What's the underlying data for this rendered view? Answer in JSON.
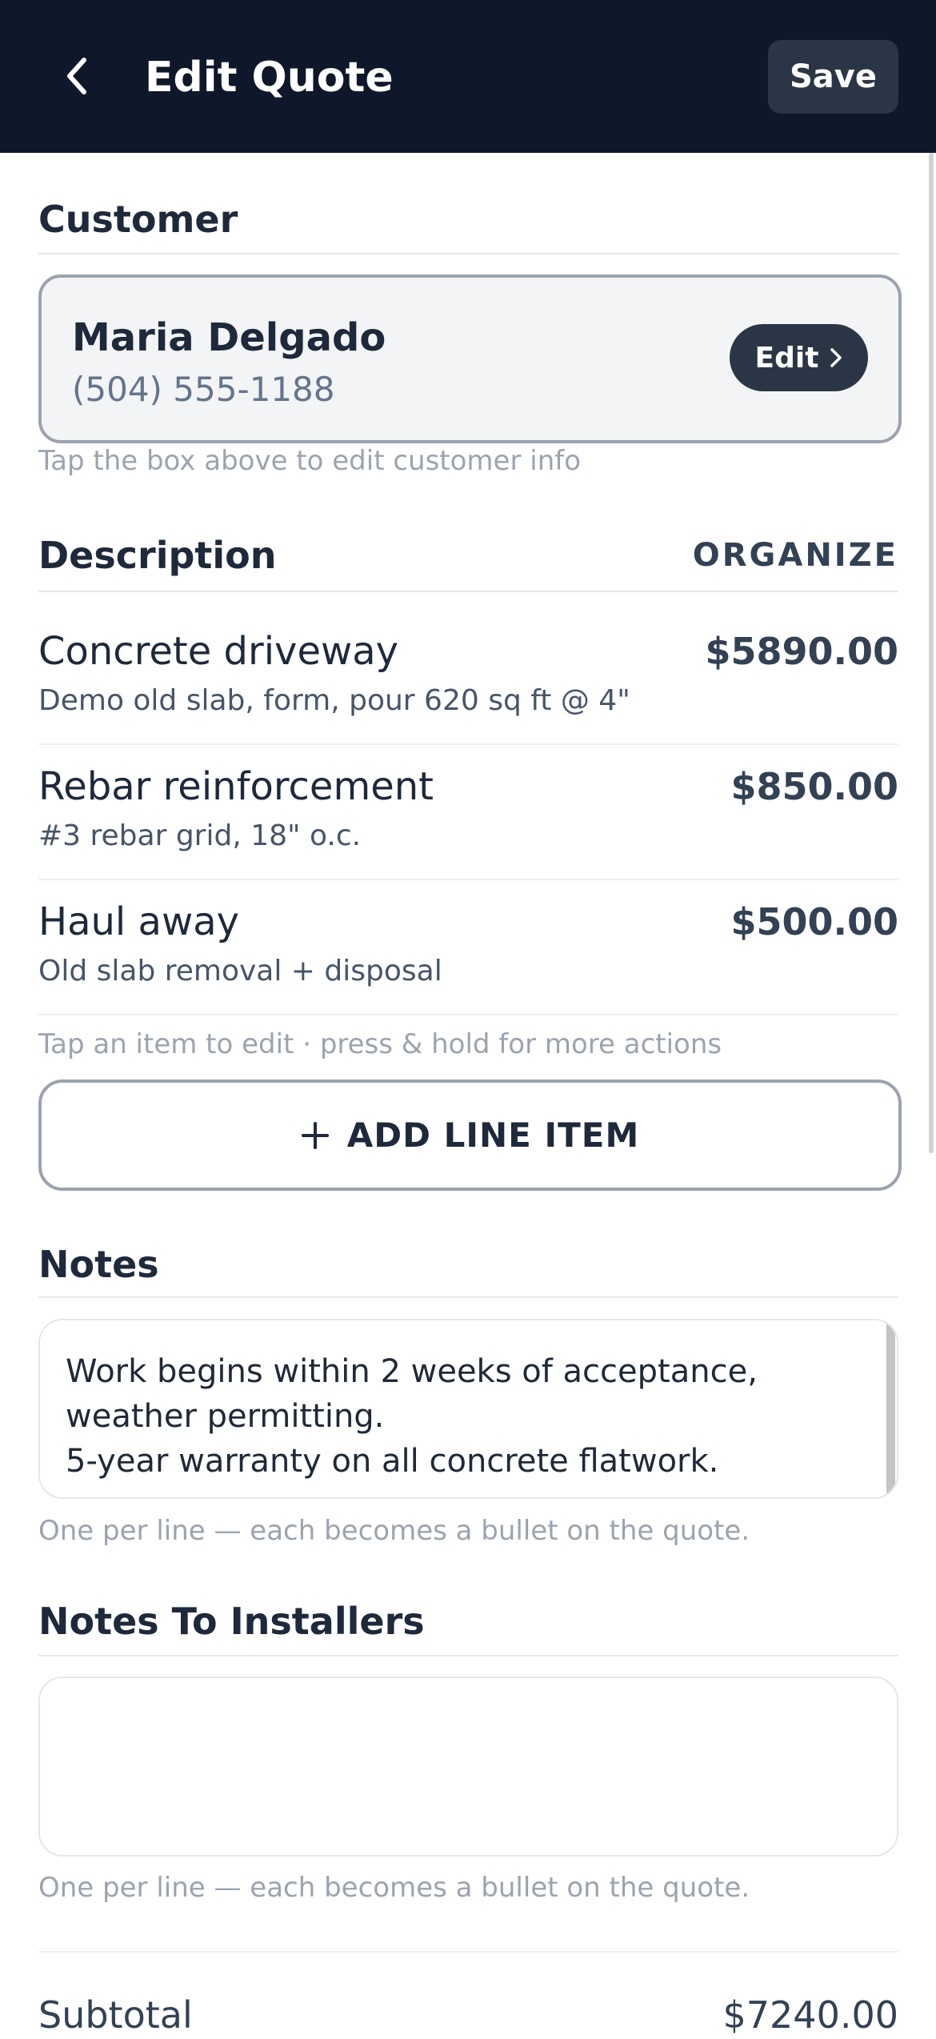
{
  "header": {
    "title": "Edit Quote",
    "save_label": "Save",
    "back_icon": "chevron-left-icon"
  },
  "customer": {
    "section_title": "Customer",
    "name": "Maria Delgado",
    "phone": "(504) 555-1188",
    "edit_label": "Edit",
    "hint": "Tap the box above to edit customer info"
  },
  "description": {
    "section_title": "Description",
    "organize_label": "ORGANIZE",
    "items": [
      {
        "name": "Concrete driveway",
        "detail": "Demo old slab, form, pour 620 sq ft @ 4\"",
        "price": "$5890.00"
      },
      {
        "name": "Rebar reinforcement",
        "detail": "#3 rebar grid, 18\" o.c.",
        "price": "$850.00"
      },
      {
        "name": "Haul away",
        "detail": "Old slab removal + disposal",
        "price": "$500.00"
      }
    ],
    "hint": "Tap an item to edit · press & hold for more actions",
    "add_label": "ADD LINE ITEM"
  },
  "notes": {
    "section_title": "Notes",
    "value": "Work begins within 2 weeks of acceptance, weather permitting.\n5-year warranty on all concrete flatwork.",
    "hint": "One per line — each becomes a bullet on the quote."
  },
  "installer_notes": {
    "section_title": "Notes To Installers",
    "value": "",
    "hint": "One per line — each becomes a bullet on the quote."
  },
  "totals": {
    "subtotal_label": "Subtotal",
    "subtotal_value": "$7240.00"
  },
  "colors": {
    "header_bg": "#0f172a",
    "button_bg": "#2a3646",
    "border": "#9ca3af",
    "hint_text": "#9ca3af"
  }
}
